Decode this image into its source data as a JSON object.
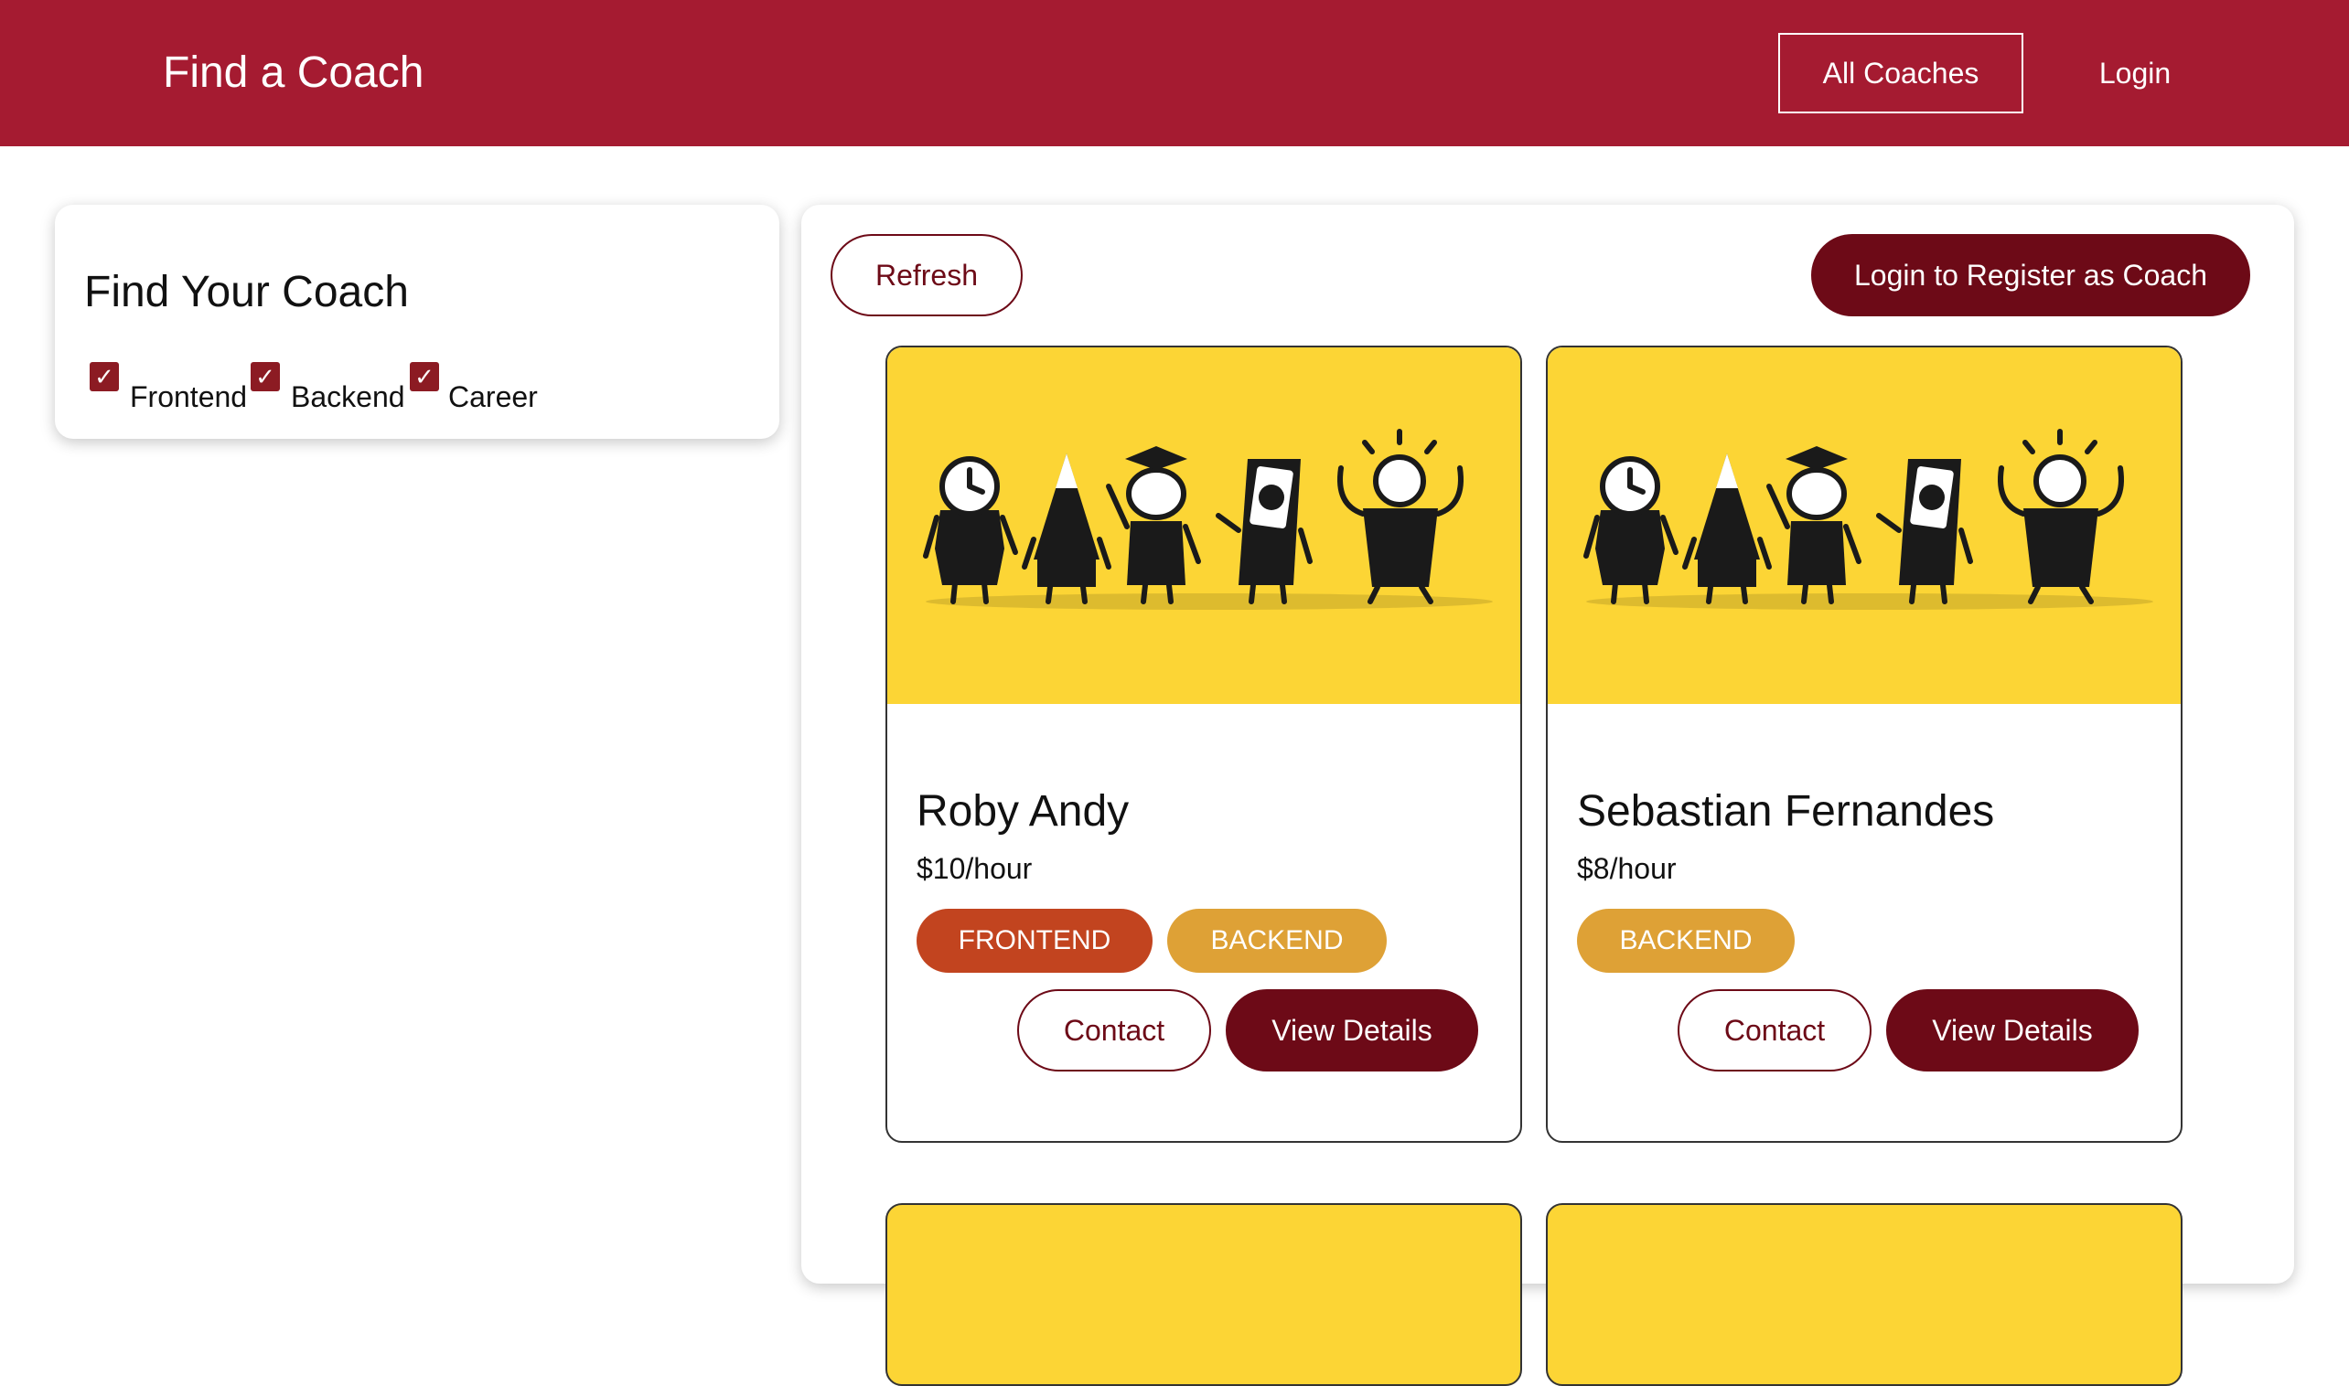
{
  "header": {
    "title": "Find a Coach",
    "nav": {
      "all_coaches": "All Coaches",
      "login": "Login"
    }
  },
  "filter": {
    "title": "Find Your Coach",
    "options": [
      {
        "label": "Frontend",
        "checked": true
      },
      {
        "label": "Backend",
        "checked": true
      },
      {
        "label": "Career",
        "checked": true
      }
    ],
    "check_glyph": "✓"
  },
  "toolbar": {
    "refresh_label": "Refresh",
    "register_label": "Login to Register as Coach"
  },
  "coaches": [
    {
      "name": "Roby Andy",
      "rate": "$10/hour",
      "areas": [
        "FRONTEND",
        "BACKEND"
      ],
      "contact_label": "Contact",
      "details_label": "View Details"
    },
    {
      "name": "Sebastian Fernandes",
      "rate": "$8/hour",
      "areas": [
        "BACKEND"
      ],
      "contact_label": "Contact",
      "details_label": "View Details"
    }
  ],
  "colors": {
    "header_bg": "#a51b31",
    "primary_dark": "#6d0a17",
    "frontend_badge": "#c2441f",
    "backend_badge": "#dea136",
    "card_image_bg": "#fcd535"
  }
}
